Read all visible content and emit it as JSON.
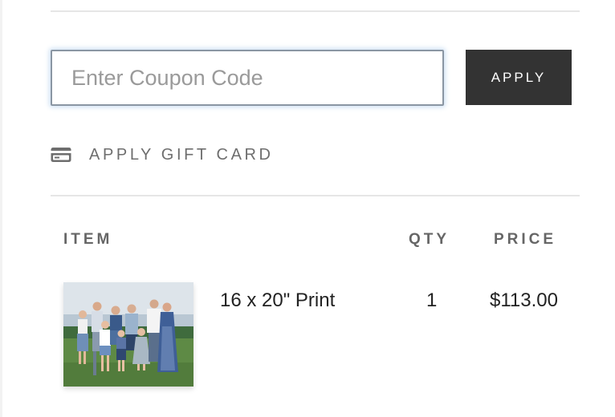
{
  "coupon": {
    "placeholder": "Enter Coupon Code",
    "value": "",
    "apply_label": "APPLY"
  },
  "gift_card": {
    "label": "APPLY GIFT CARD",
    "icon": "credit-card-icon"
  },
  "cart_table": {
    "headers": {
      "item": "ITEM",
      "qty": "QTY",
      "price": "PRICE"
    },
    "rows": [
      {
        "name": "16 x 20\" Print",
        "qty": "1",
        "price": "$113.00",
        "thumbnail": "family-photo"
      }
    ]
  },
  "colors": {
    "button_bg": "#333333",
    "input_border": "#8a96a3",
    "divider": "#e6e6e6",
    "muted_text": "#6e6e6e"
  }
}
